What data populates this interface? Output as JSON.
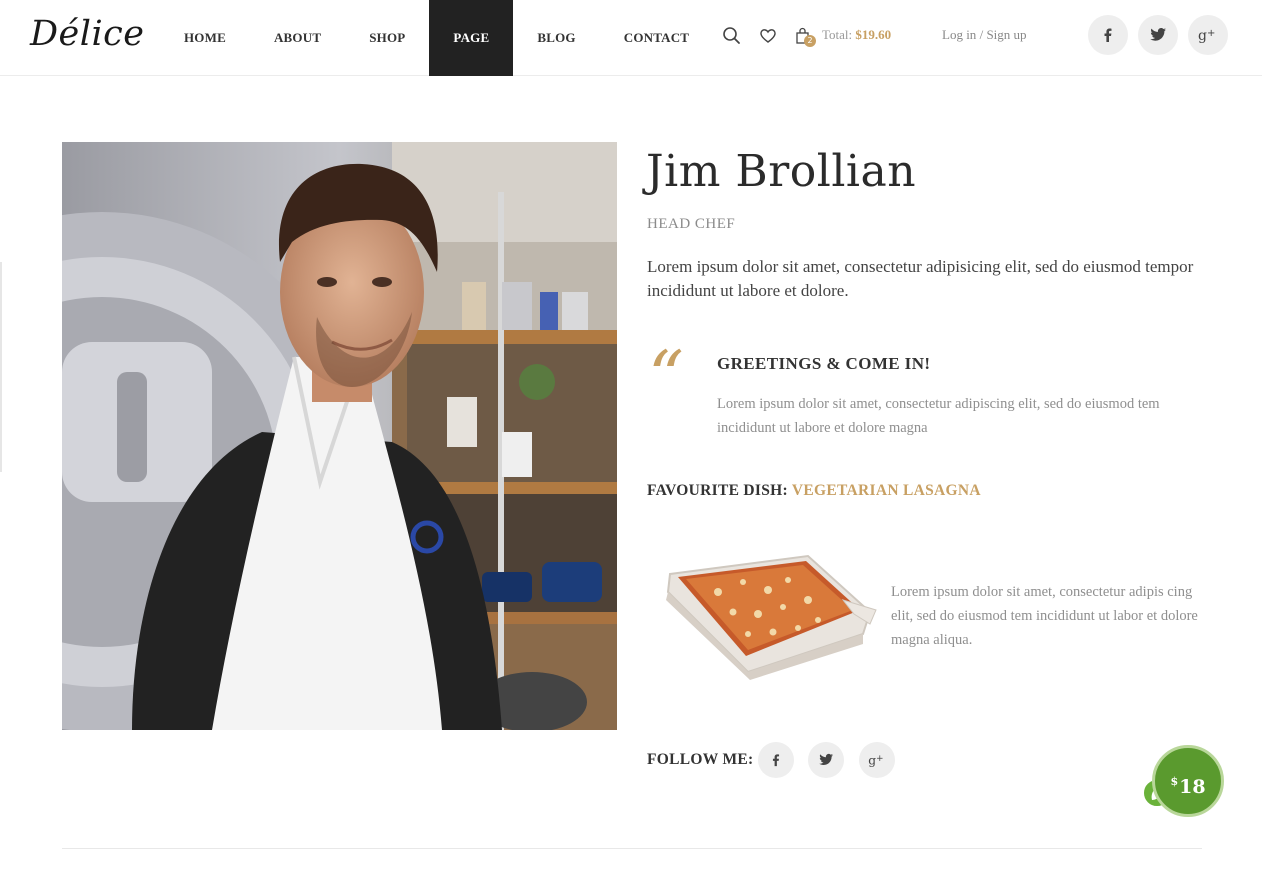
{
  "brand": {
    "logo_text": "Délice",
    "accent_color": "#c8a063"
  },
  "nav": {
    "items": [
      {
        "label": "HOME"
      },
      {
        "label": "ABOUT"
      },
      {
        "label": "SHOP"
      },
      {
        "label": "PAGE",
        "active": true
      },
      {
        "label": "BLOG"
      },
      {
        "label": "CONTACT"
      }
    ]
  },
  "header": {
    "search_icon": "search-icon",
    "wishlist_icon": "heart-icon",
    "cart_icon": "shopping-bag-icon",
    "cart_count": "2",
    "total_label": "Total:",
    "total_amount": "$19.60",
    "login_label": "Log in",
    "separator": "/",
    "signup_label": "Sign up",
    "social": [
      "facebook-icon",
      "twitter-icon",
      "google-plus-icon"
    ]
  },
  "profile": {
    "name": "Jim Brollian",
    "role": "HEAD CHEF",
    "intro": "Lorem ipsum dolor sit amet, consectetur adipisicing elit, sed do eiusmod tempor incididunt ut labore et dolore.",
    "quote": {
      "mark": "“",
      "title": "GREETINGS & COME IN!",
      "text": "Lorem ipsum dolor sit amet, consectetur adipiscing elit, sed do eiusmod tem incididunt ut labore et dolore magna"
    },
    "favourite_label": "FAVOURITE DISH:",
    "favourite_dish": "VEGETARIAN LASAGNA",
    "dish_text": "Lorem ipsum dolor sit amet, consectetur adipis cing elit, sed do eiusmod tem incididunt ut labor et dolore magna aliqua.",
    "follow_label": "FOLLOW ME:",
    "follow_social": [
      "facebook-icon",
      "twitter-icon",
      "google-plus-icon"
    ]
  },
  "price_badge": {
    "currency": "$",
    "amount": "18"
  }
}
